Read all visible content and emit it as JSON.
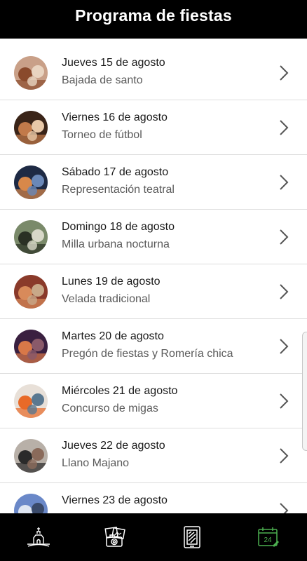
{
  "header": {
    "title": "Programa de fiestas"
  },
  "events": [
    {
      "date": "Jueves 15 de agosto",
      "event": "Bajada de santo",
      "colors": [
        "#c9a088",
        "#8a4a2c",
        "#e9d4c0"
      ]
    },
    {
      "date": "Viernes 16 de agosto",
      "event": "Torneo de fútbol",
      "colors": [
        "#3a2418",
        "#c27a4a",
        "#e8c8a8"
      ]
    },
    {
      "date": "Sábado 17 de agosto",
      "event": "Representación teatral",
      "colors": [
        "#1e2a44",
        "#d8884a",
        "#6a88b8"
      ]
    },
    {
      "date": "Domingo 18 de agosto",
      "event": "Milla urbana nocturna",
      "colors": [
        "#7a8a6a",
        "#2a3024",
        "#d8d8c8"
      ]
    },
    {
      "date": "Lunes 19 de agosto",
      "event": "Velada tradicional",
      "colors": [
        "#8a3a2a",
        "#d88a5a",
        "#c8a888"
      ]
    },
    {
      "date": "Martes 20 de agosto",
      "event": "Pregón de fiestas y Romería chica",
      "colors": [
        "#3a2040",
        "#d87848",
        "#8a5a6a"
      ]
    },
    {
      "date": "Miércoles 21 de agosto",
      "event": "Concurso de migas",
      "colors": [
        "#e8e0d8",
        "#e86a28",
        "#5a7890"
      ]
    },
    {
      "date": "Jueves 22 de agosto",
      "event": "Llano Majano",
      "colors": [
        "#b8b0a8",
        "#2a2a2a",
        "#8a6a5a"
      ]
    },
    {
      "date": "Viernes 23 de agosto",
      "event": "",
      "colors": [
        "#6a88c8",
        "#dfe6f2",
        "#3a4a6a"
      ]
    }
  ],
  "nav": {
    "items": [
      {
        "icon": "church-icon"
      },
      {
        "icon": "photo-gallery-icon"
      },
      {
        "icon": "phone-document-icon"
      },
      {
        "icon": "calendar-icon",
        "label": "24",
        "active": true
      }
    ],
    "active_color": "#4caf50"
  }
}
